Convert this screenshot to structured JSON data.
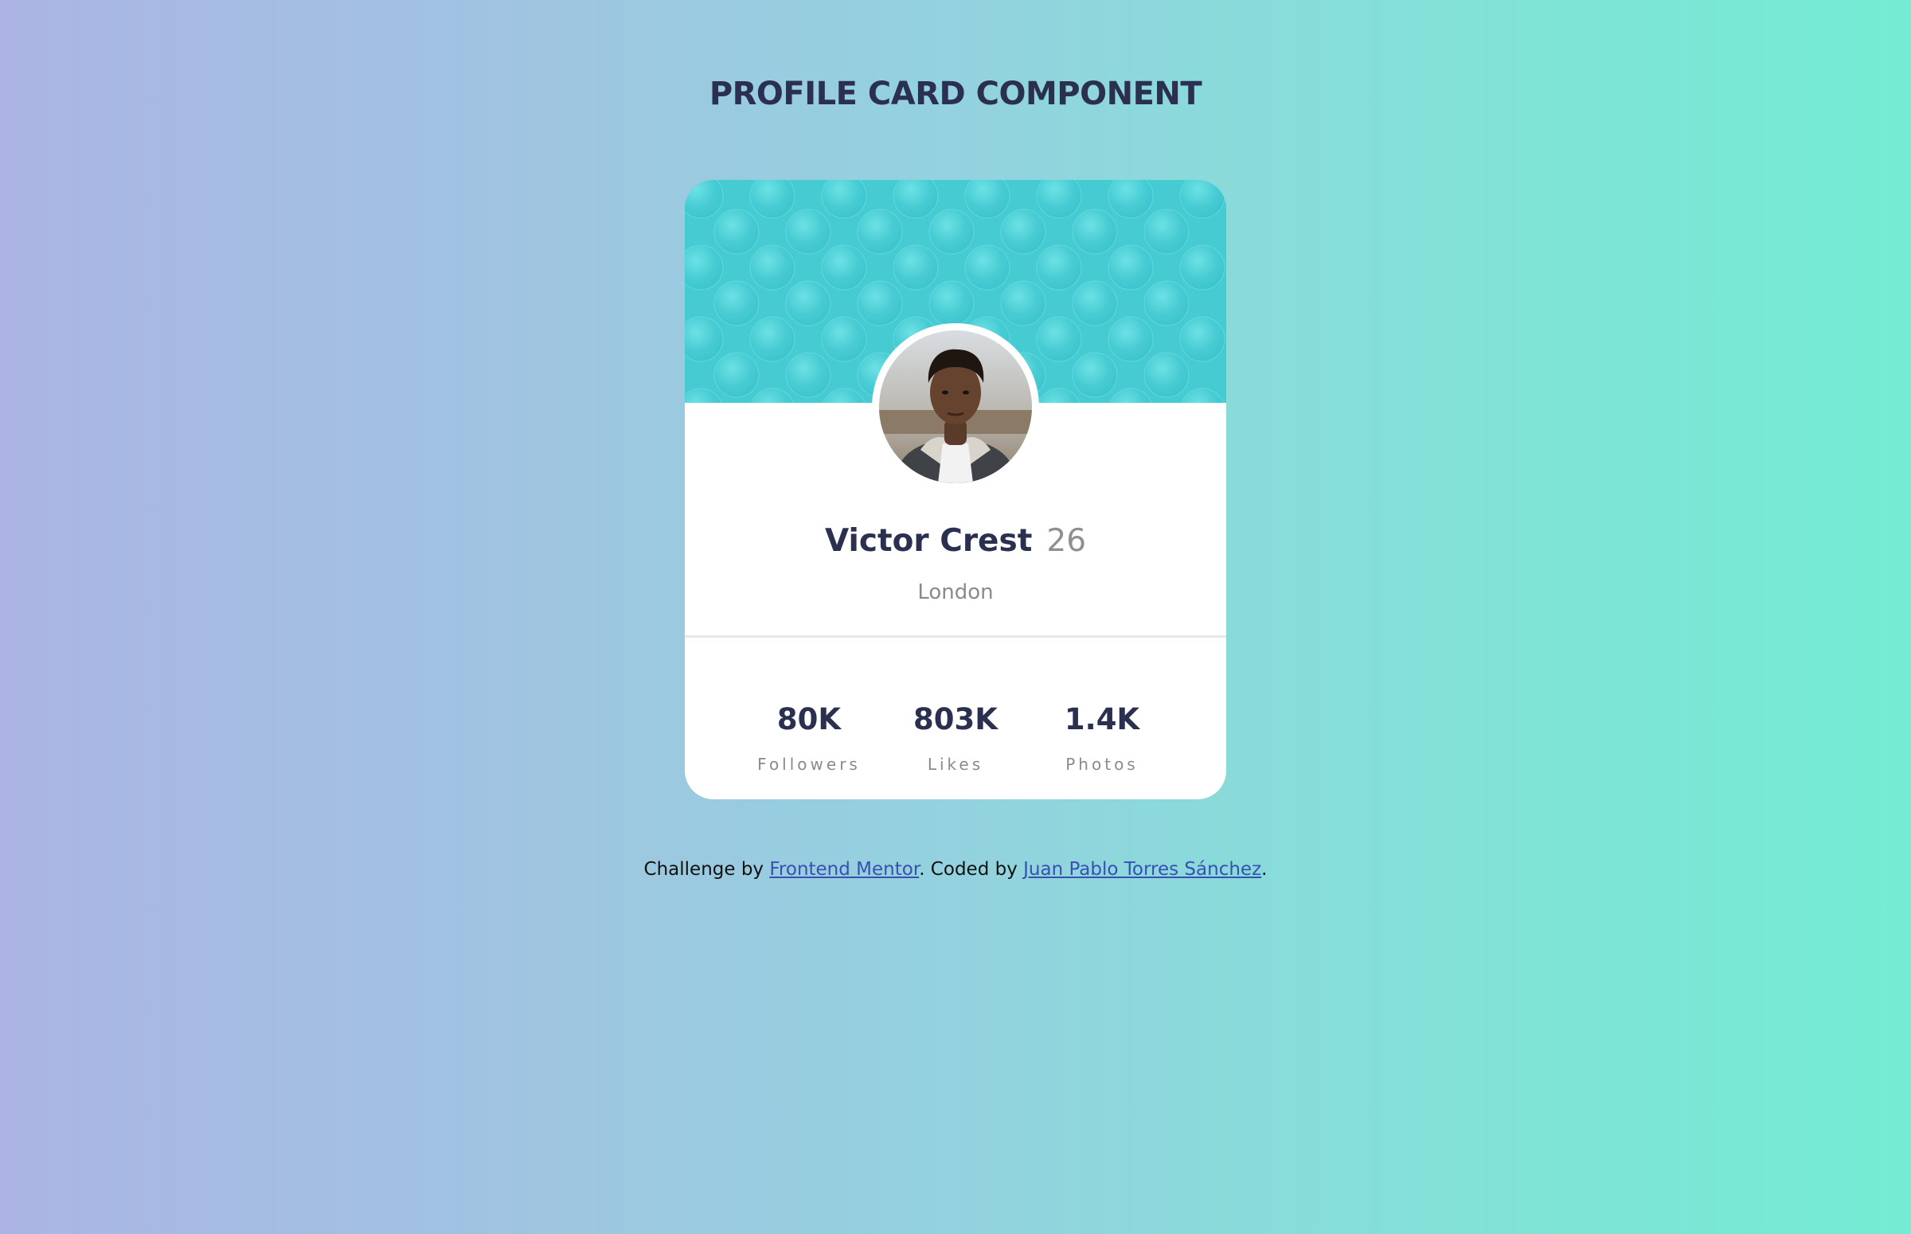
{
  "page": {
    "title": "PROFILE CARD COMPONENT"
  },
  "profile": {
    "name": "Victor Crest",
    "age": "26",
    "location": "London",
    "avatar_icon": "profile-photo",
    "banner_pattern": "circles-pattern",
    "stats": [
      {
        "value": "80K",
        "label": "Followers"
      },
      {
        "value": "803K",
        "label": "Likes"
      },
      {
        "value": "1.4K",
        "label": "Photos"
      }
    ]
  },
  "footer": {
    "prefix": "Challenge by ",
    "link1": "Frontend Mentor",
    "middle": ". Coded by ",
    "link2": "Juan Pablo Torres Sánchez",
    "suffix": "."
  },
  "colors": {
    "background_left": "#abb4e4",
    "background_right": "#74ecd4",
    "banner": "#4dcfd6",
    "text_dark": "#2b3050",
    "text_muted": "#8a8a8a",
    "link": "#3a4fb2"
  }
}
